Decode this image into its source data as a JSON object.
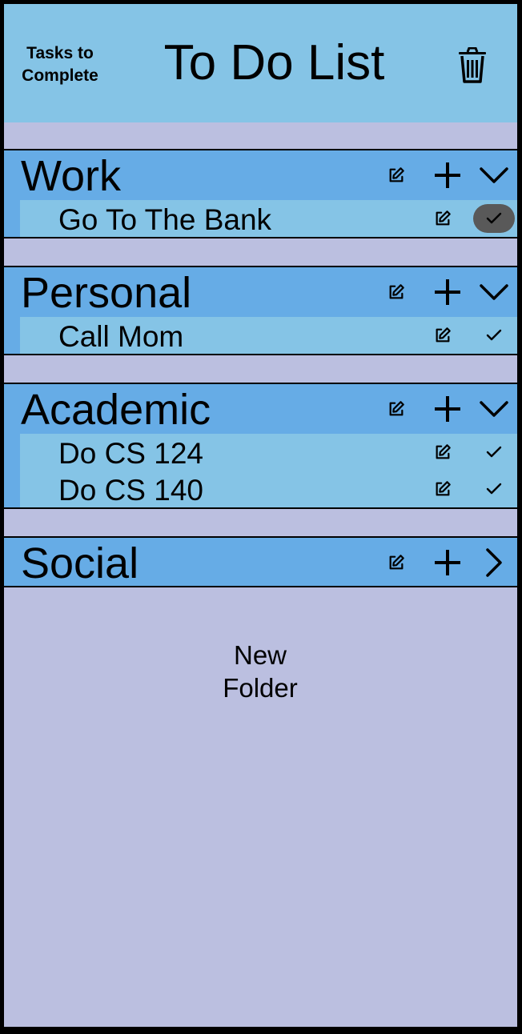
{
  "header": {
    "tasks_button": "Tasks to\nComplete",
    "title": "To Do List",
    "trash_icon": "trash-icon"
  },
  "folders": [
    {
      "name": "Work",
      "expanded": true,
      "tasks": [
        {
          "label": "Go To The Bank",
          "check_highlighted": true
        }
      ]
    },
    {
      "name": "Personal",
      "expanded": true,
      "tasks": [
        {
          "label": "Call Mom",
          "check_highlighted": false
        }
      ]
    },
    {
      "name": "Academic",
      "expanded": true,
      "tasks": [
        {
          "label": "Do CS 124",
          "check_highlighted": false
        },
        {
          "label": "Do CS 140",
          "check_highlighted": false
        }
      ]
    },
    {
      "name": "Social",
      "expanded": false,
      "tasks": []
    }
  ],
  "new_folder": "New\nFolder",
  "colors": {
    "background": "#bbbfe0",
    "header": "#85c4e6",
    "folder": "#66ace6",
    "task": "#85c4e6",
    "highlight": "#595959"
  }
}
